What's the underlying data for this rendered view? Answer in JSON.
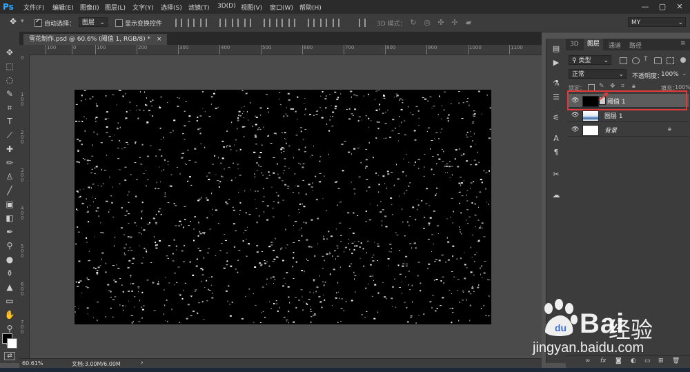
{
  "app": {
    "logo": "Ps"
  },
  "menu": [
    "文件(F)",
    "编辑(E)",
    "图像(I)",
    "图层(L)",
    "文字(Y)",
    "选择(S)",
    "滤镜(T)",
    "3D(D)",
    "视图(V)",
    "窗口(W)",
    "帮助(H)"
  ],
  "window_controls": {
    "minimize": "—",
    "maximize": "▢",
    "close": "✕"
  },
  "options": {
    "auto_select_label": "自动选择：",
    "auto_select_value": "图层",
    "show_transform_label": "显示变换控件",
    "mode_3d_label": "3D 模式：",
    "workspace": "MY"
  },
  "document": {
    "tab_title": "雪花制作.psd @ 60.6% (阈值 1, RGB/8) *",
    "tab_close": "×",
    "zoom": "60.61%",
    "doc_size": "文档:3.00M/6.00M"
  },
  "ruler_top": [
    "100",
    "0",
    "100",
    "200",
    "300",
    "400",
    "500",
    "600",
    "700",
    "800",
    "900",
    "1000",
    "1100",
    "1200"
  ],
  "ruler_left": [
    "0",
    "1 0 0",
    "2 0 0",
    "3 0 0",
    "4 0 0",
    "5 0 0",
    "6 0 0",
    "7 0 0",
    "8 0 0"
  ],
  "layers_panel": {
    "tabs": [
      "3D",
      "图层",
      "通道",
      "路径"
    ],
    "active_tab": "图层",
    "filter_kind": "类型",
    "blend_mode": "正常",
    "opacity_label": "不透明度：",
    "opacity_value": "100%",
    "lock_label": "锁定：",
    "fill_label": "填充：",
    "fill_value": "100%",
    "layers": [
      {
        "name": "阈值 1",
        "selected": true
      },
      {
        "name": "图层 1",
        "selected": false
      },
      {
        "name": "背景",
        "selected": false,
        "locked": true
      }
    ]
  },
  "watermark": {
    "brand": "Bai",
    "brand_cn": "经验",
    "url": "jingyan.baidu.com"
  },
  "colors": {
    "highlight_box": "#e03a3a",
    "accent": "#31a8ff"
  }
}
